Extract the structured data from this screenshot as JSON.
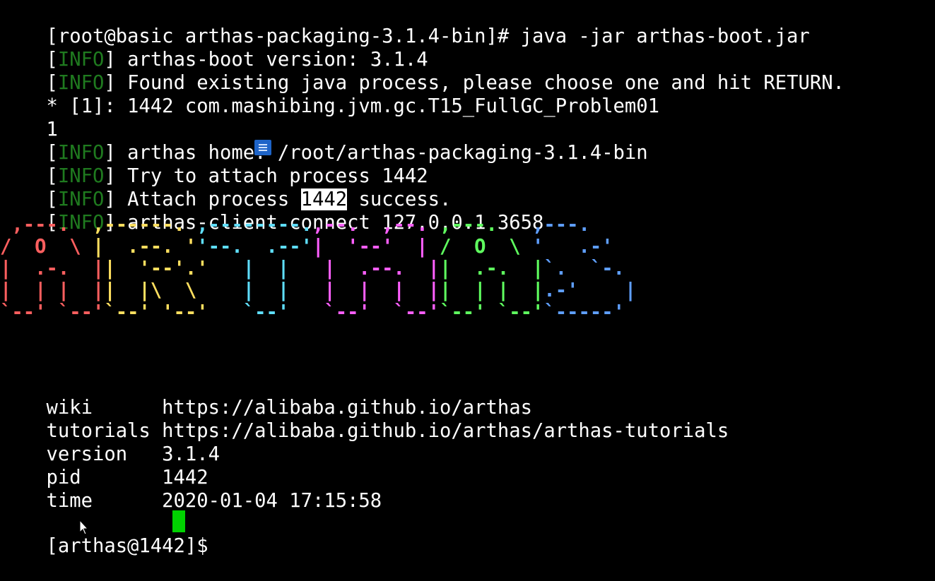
{
  "terminal": {
    "lines": [
      "[root@basic arthas-packaging-3.1.4-bin]# java -jar arthas-boot.jar",
      {
        "tag": "INFO",
        "text": "arthas-boot version: 3.1.4"
      },
      {
        "tag": "INFO",
        "text": "Found existing java process, please choose one and hit RETURN."
      },
      "* [1]: 1442 com.mashibing.jvm.gc.T15_FullGC_Problem01",
      "1",
      {
        "tag": "INFO",
        "text": "arthas home: /root/arthas-packaging-3.1.4-bin"
      },
      {
        "tag": "INFO",
        "text": "Try to attach process 1442"
      },
      {
        "tag": "INFO",
        "text_before": "Attach process ",
        "highlight": "1442",
        "text_after": " success."
      },
      {
        "tag": "INFO",
        "text": "arthas-client connect 127.0.0.1 3658"
      }
    ],
    "logo_rows": [
      [
        [
          " ,---.  ",
          "red"
        ],
        [
          ",------. ",
          "yellow"
        ],
        [
          ",--------.",
          "cyan"
        ],
        [
          ",--.  ,--. ",
          "magenta"
        ],
        [
          ",---.  ",
          "green"
        ],
        [
          " ,---.",
          "blue"
        ]
      ],
      [
        [
          "/  O  \\ ",
          "red"
        ],
        [
          "|  .--. '",
          "yellow"
        ],
        [
          "'--.  .--'",
          "cyan"
        ],
        [
          "|  '--'  | ",
          "magenta"
        ],
        [
          "/  O  \\ ",
          "green"
        ],
        [
          "'   .-'",
          "blue"
        ]
      ],
      [
        [
          "|  .-.  |",
          "red"
        ],
        [
          "|  '--'.'",
          "yellow"
        ],
        [
          "   |  |   ",
          "cyan"
        ],
        [
          "|  .--.  |",
          "magenta"
        ],
        [
          "|  .-.  |",
          "green"
        ],
        [
          "`.  `-.",
          "blue"
        ]
      ],
      [
        [
          "|  | |  |",
          "red"
        ],
        [
          "|  |\\  \\ ",
          "yellow"
        ],
        [
          "   |  |   ",
          "cyan"
        ],
        [
          "|  |  |  |",
          "magenta"
        ],
        [
          "|  | |  |",
          "green"
        ],
        [
          ".-'    |",
          "blue"
        ]
      ],
      [
        [
          "`--' `--'",
          "red"
        ],
        [
          "`--' '--'",
          "yellow"
        ],
        [
          "   `--'   ",
          "cyan"
        ],
        [
          "`--'  `--'",
          "magenta"
        ],
        [
          "`--' `--'",
          "green"
        ],
        [
          "`-----'",
          "blue"
        ]
      ]
    ],
    "info_table": [
      {
        "key": "wiki      ",
        "value": "https://alibaba.github.io/arthas"
      },
      {
        "key": "tutorials ",
        "value": "https://alibaba.github.io/arthas/arthas-tutorials"
      },
      {
        "key": "version   ",
        "value": "3.1.4"
      },
      {
        "key": "pid       ",
        "value": "1442"
      },
      {
        "key": "time      ",
        "value": "2020-01-04 17:15:58"
      }
    ],
    "prompt": "[arthas@1442]$ "
  },
  "colors": {
    "background": "#000000",
    "text": "#ffffff",
    "info_tag": "#1f7a1f",
    "cursor": "#00d200",
    "logo_red": "#ff5f5f",
    "logo_yellow": "#ffdf5f",
    "logo_cyan": "#5fdfff",
    "logo_magenta": "#ff5fff",
    "logo_green": "#5fff5f",
    "logo_blue": "#5f9fff"
  },
  "icons": {
    "note": "note-icon",
    "pointer": "mouse-pointer-icon"
  }
}
